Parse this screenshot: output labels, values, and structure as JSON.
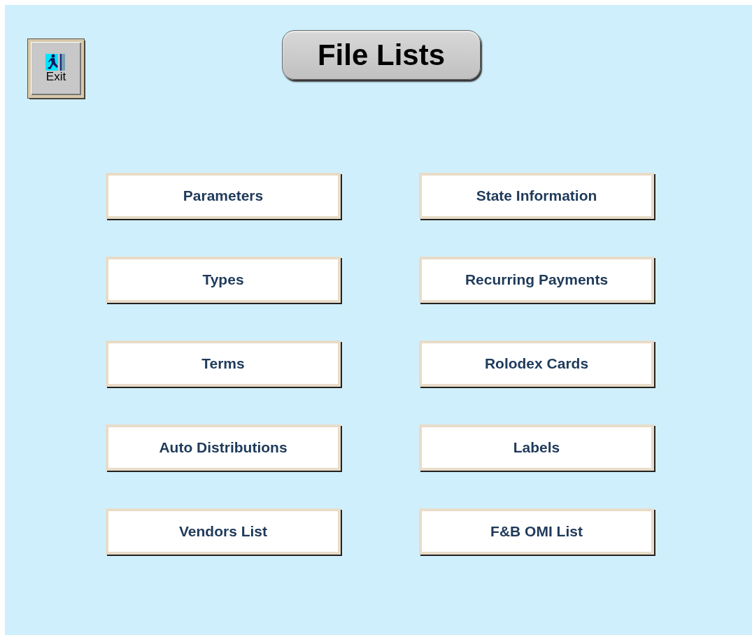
{
  "exit_button": {
    "label": "Exit"
  },
  "title": "File Lists",
  "buttons": [
    "Parameters",
    "State Information",
    "Types",
    "Recurring Payments",
    "Terms",
    "Rolodex Cards",
    "Auto Distributions",
    "Labels",
    "Vendors List",
    "F&B OMI List"
  ]
}
